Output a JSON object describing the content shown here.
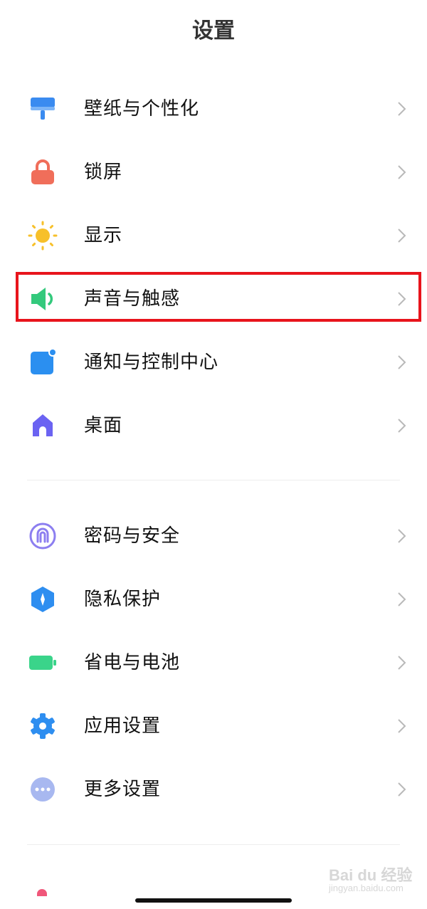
{
  "header": {
    "title": "设置"
  },
  "groups": [
    {
      "items": [
        {
          "label": "壁纸与个性化",
          "icon": "wallpaper-icon",
          "color": "#3a8bf0"
        },
        {
          "label": "锁屏",
          "icon": "lock-icon",
          "color": "#f06e5a"
        },
        {
          "label": "显示",
          "icon": "sun-icon",
          "color": "#f7c02a"
        },
        {
          "label": "声音与触感",
          "icon": "speaker-icon",
          "color": "#33c97c",
          "highlighted": true
        },
        {
          "label": "通知与控制中心",
          "icon": "notification-icon",
          "color": "#2b8ff0"
        },
        {
          "label": "桌面",
          "icon": "home-icon",
          "color": "#6b63f2"
        }
      ]
    },
    {
      "items": [
        {
          "label": "密码与安全",
          "icon": "fingerprint-icon",
          "color": "#8c7ef0"
        },
        {
          "label": "隐私保护",
          "icon": "privacy-shield-icon",
          "color": "#2e8ef0"
        },
        {
          "label": "省电与电池",
          "icon": "battery-icon",
          "color": "#3ad48a"
        },
        {
          "label": "应用设置",
          "icon": "gear-icon",
          "color": "#2e8ef0"
        },
        {
          "label": "更多设置",
          "icon": "more-icon",
          "color": "#a8b8f0"
        }
      ]
    }
  ],
  "watermark": {
    "line1": "Bai du 经验",
    "line2": "jingyan.baidu.com"
  },
  "colors": {
    "highlight_border": "#e8141c",
    "chevron": "#b9b9b9",
    "divider": "#eeeeee"
  }
}
